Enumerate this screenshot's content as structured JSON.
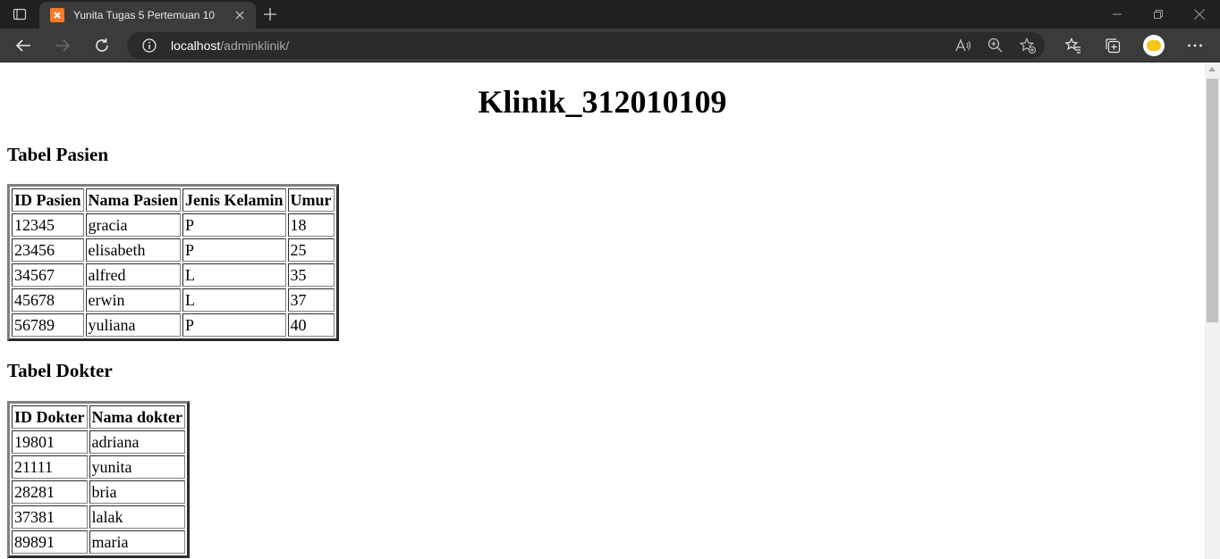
{
  "browser": {
    "tab_title": "Yunita Tugas 5 Pertemuan 10",
    "url_host": "localhost",
    "url_path": "/adminklinik/"
  },
  "page": {
    "title": "Klinik_312010109",
    "pasien": {
      "heading": "Tabel Pasien",
      "headers": [
        "ID Pasien",
        "Nama Pasien",
        "Jenis Kelamin",
        "Umur"
      ],
      "rows": [
        [
          "12345",
          "gracia",
          "P",
          "18"
        ],
        [
          "23456",
          "elisabeth",
          "P",
          "25"
        ],
        [
          "34567",
          "alfred",
          "L",
          "35"
        ],
        [
          "45678",
          "erwin",
          "L",
          "37"
        ],
        [
          "56789",
          "yuliana",
          "P",
          "40"
        ]
      ]
    },
    "dokter": {
      "heading": "Tabel Dokter",
      "headers": [
        "ID Dokter",
        "Nama dokter"
      ],
      "rows": [
        [
          "19801",
          "adriana"
        ],
        [
          "21111",
          "yunita"
        ],
        [
          "28281",
          "bria"
        ],
        [
          "37381",
          "lalak"
        ],
        [
          "89891",
          "maria"
        ]
      ]
    }
  },
  "colors": {
    "tabbar": "#202020",
    "toolbar": "#3b3b3b",
    "favicon": "#fb7a24"
  }
}
